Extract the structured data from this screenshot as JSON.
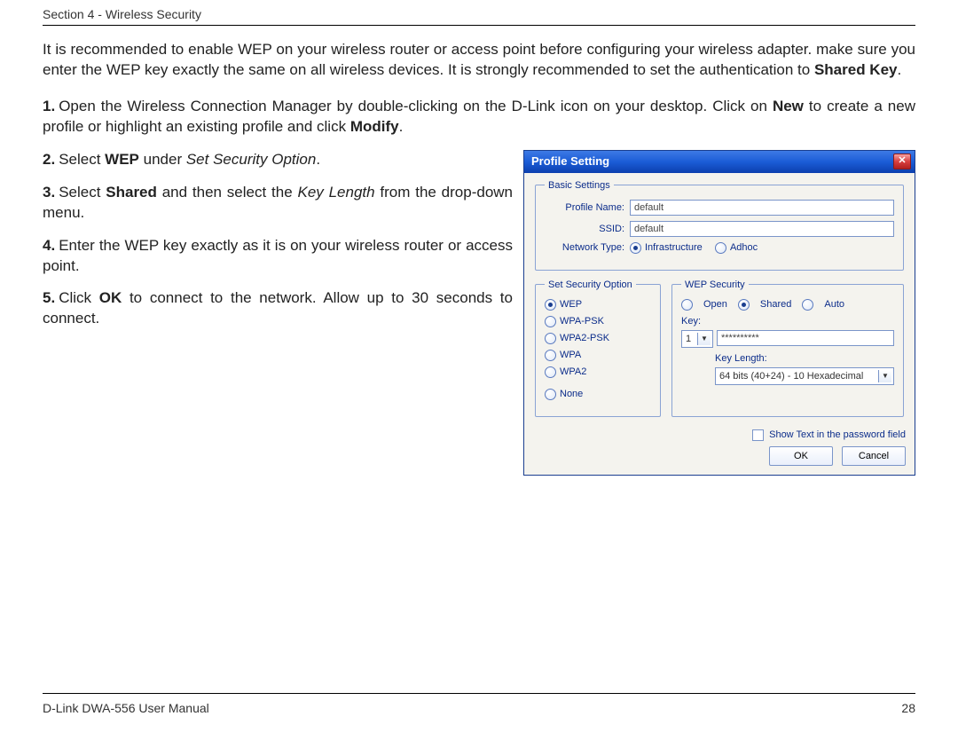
{
  "header": {
    "section": "Section 4 - Wireless Security"
  },
  "intro": {
    "text_before_bold": "It is recommended to enable WEP on your wireless router or access point before configuring your wireless adapter. make sure you enter the WEP key exactly the same on all wireless devices. It is strongly recommended to set the authentication to ",
    "bold": "Shared Key",
    "after": "."
  },
  "step1": {
    "num": "1.",
    "a": "Open the Wireless Connection Manager by double-clicking on the D-Link icon on your desktop. Click on ",
    "b1": "New",
    "c": " to create a new profile or highlight an existing profile and click ",
    "b2": "Modify",
    "d": "."
  },
  "step2": {
    "num": "2.",
    "a": "Select ",
    "b": "WEP",
    "c": " under ",
    "i": "Set Security Option",
    "d": "."
  },
  "step3": {
    "num": "3.",
    "a": "Select ",
    "b": "Shared",
    "c": " and then select the ",
    "i": "Key Length",
    "d": " from the drop-down menu."
  },
  "step4": {
    "num": "4.",
    "a": "Enter the WEP key exactly as it is on your wireless router or access point."
  },
  "step5": {
    "num": "5.",
    "a": "Click ",
    "b": "OK",
    "c": " to connect to the network. Allow up to 30 seconds to connect."
  },
  "dialog": {
    "title": "Profile Setting",
    "basic_legend": "Basic Settings",
    "profile_name_label": "Profile Name:",
    "profile_name_value": "default",
    "ssid_label": "SSID:",
    "ssid_value": "default",
    "network_type_label": "Network Type:",
    "nt_infra": "Infrastructure",
    "nt_adhoc": "Adhoc",
    "sec_legend": "Set Security Option",
    "opt_wep": "WEP",
    "opt_wpapsk": "WPA-PSK",
    "opt_wpa2psk": "WPA2-PSK",
    "opt_wpa": "WPA",
    "opt_wpa2": "WPA2",
    "opt_none": "None",
    "wep_legend": "WEP Security",
    "wep_open": "Open",
    "wep_shared": "Shared",
    "wep_auto": "Auto",
    "key_label": "Key:",
    "key_index": "1",
    "key_masked": "**********",
    "keylen_label": "Key Length:",
    "keylen_value": "64 bits (40+24) - 10 Hexadecimal",
    "show_text": "Show Text in the password field",
    "ok": "OK",
    "cancel": "Cancel"
  },
  "footer": {
    "left": "D-Link DWA-556 User Manual",
    "right": "28"
  }
}
